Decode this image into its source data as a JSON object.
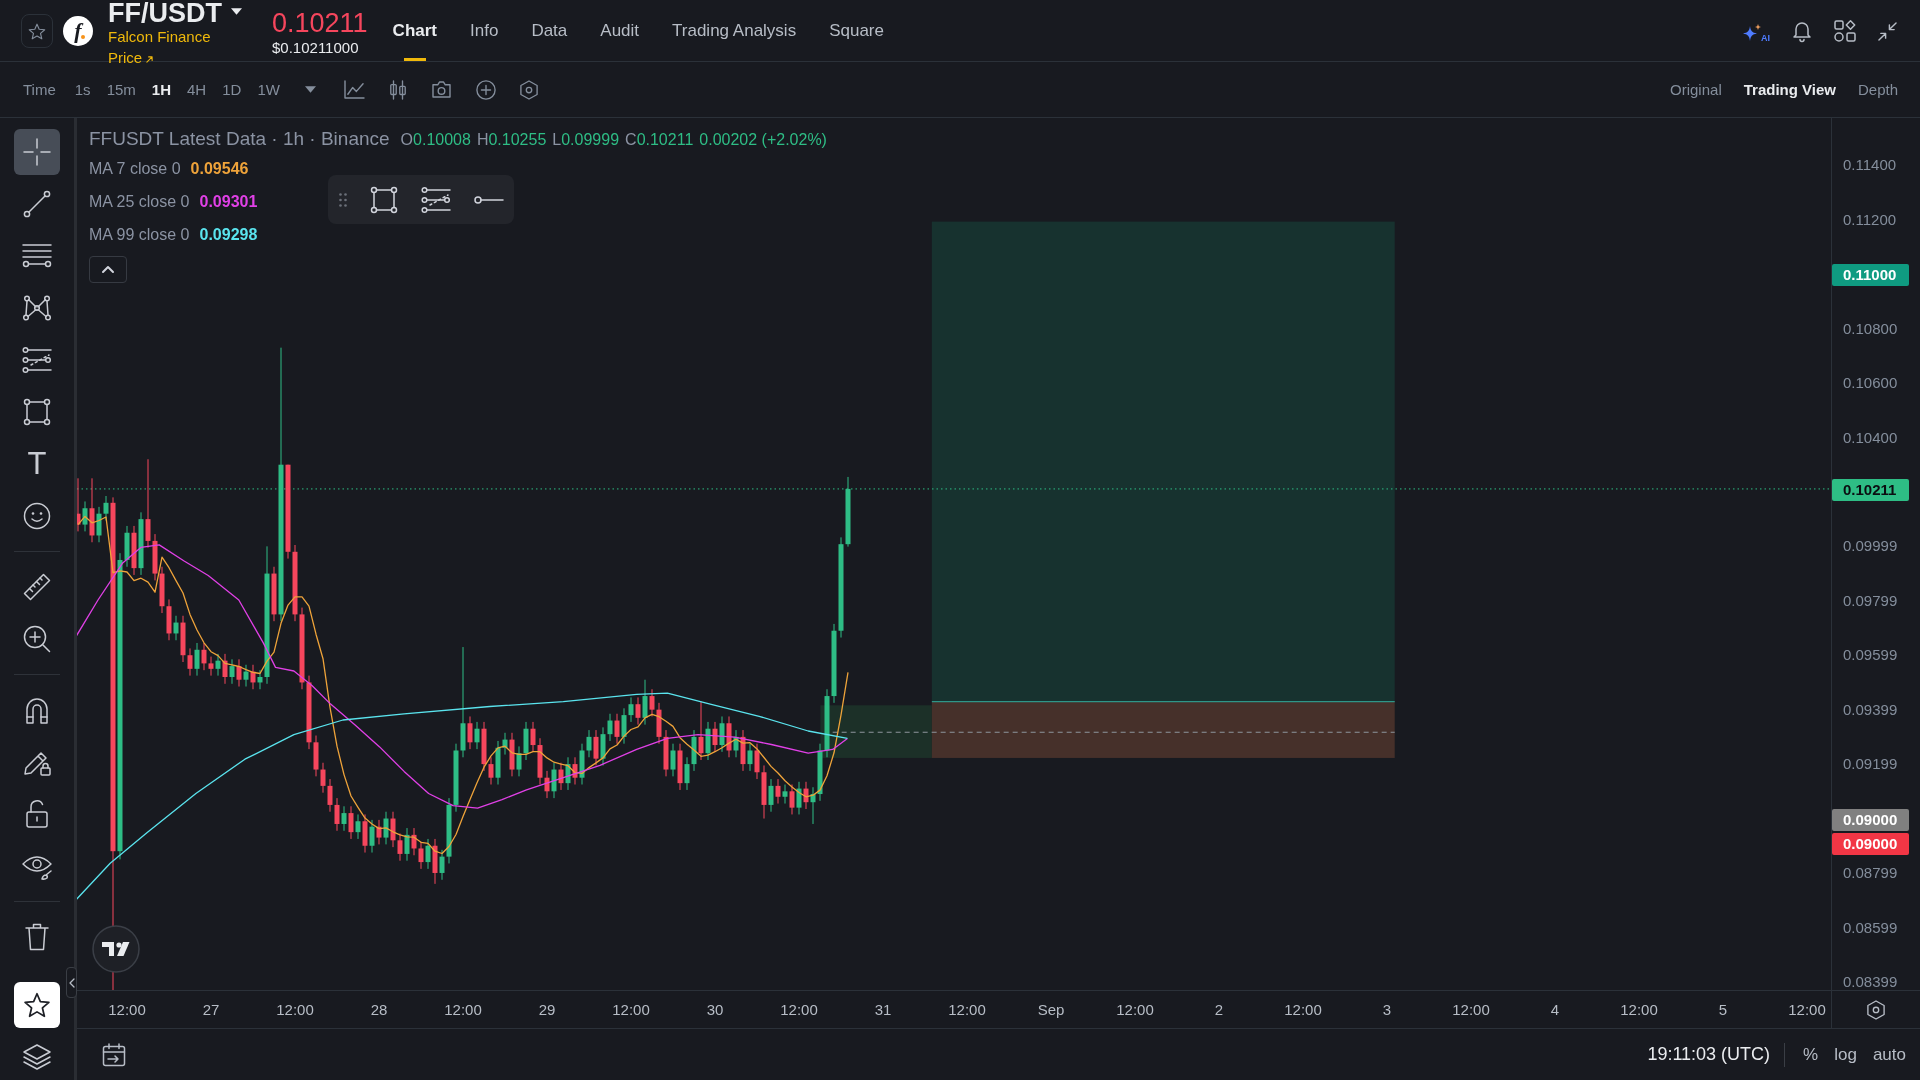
{
  "header": {
    "logo_mark": "f",
    "symbol": "FF/USDT",
    "coin_name": "Falcon Finance",
    "price_link": "Price",
    "last_price": "0.10211",
    "last_price_usd": "$0.10211000",
    "tabs": [
      {
        "label": "Chart",
        "selected": true
      },
      {
        "label": "Info",
        "selected": false
      },
      {
        "label": "Data",
        "selected": false
      },
      {
        "label": "Audit",
        "selected": false
      },
      {
        "label": "Trading Analysis",
        "selected": false
      },
      {
        "label": "Square",
        "selected": false
      }
    ],
    "ai_label": "AI"
  },
  "toolbar": {
    "time_label": "Time",
    "intervals": [
      {
        "label": "1s",
        "selected": false
      },
      {
        "label": "15m",
        "selected": false
      },
      {
        "label": "1H",
        "selected": true
      },
      {
        "label": "4H",
        "selected": false
      },
      {
        "label": "1D",
        "selected": false
      },
      {
        "label": "1W",
        "selected": false
      }
    ],
    "views": [
      {
        "label": "Original",
        "selected": false
      },
      {
        "label": "Trading View",
        "selected": true
      },
      {
        "label": "Depth",
        "selected": false
      }
    ]
  },
  "drawing_tools": {
    "groups": [
      [
        {
          "selected": true
        },
        {
          "selected": false
        },
        {
          "selected": false
        },
        {
          "selected": false
        },
        {
          "selected": false
        },
        {
          "selected": false
        },
        {
          "selected": false,
          "glyph": "T"
        },
        {
          "selected": false
        }
      ],
      [
        {
          "selected": false
        },
        {
          "selected": false
        }
      ],
      [
        {
          "selected": false
        },
        {
          "selected": false
        },
        {
          "selected": false
        },
        {
          "selected": false
        }
      ],
      [
        {
          "selected": false
        }
      ]
    ],
    "favorites": {
      "on": true
    }
  },
  "legend": {
    "title": "FFUSDT Latest Data · 1h · Binance",
    "ohlc": [
      {
        "label": "O",
        "value": "0.10008"
      },
      {
        "label": "H",
        "value": "0.10255"
      },
      {
        "label": "L",
        "value": "0.09999"
      },
      {
        "label": "C",
        "value": "0.10211"
      }
    ],
    "change": "0.00202 (+2.02%)",
    "indicators": [
      {
        "label": "MA 7 close 0",
        "value": "0.09546",
        "color": "#eea33a"
      },
      {
        "label": "MA 25 close 0",
        "value": "0.09301",
        "color": "#e040e6"
      },
      {
        "label": "MA 99 close 0",
        "value": "0.09298",
        "color": "#5ae4ee"
      }
    ]
  },
  "price_axis": {
    "ticks": [
      "0.11400",
      "0.11200",
      "0.10800",
      "0.10600",
      "0.10400",
      "0.09999",
      "0.09799",
      "0.09599",
      "0.09399",
      "0.09199",
      "0.08799",
      "0.08599",
      "0.08399"
    ],
    "tags": [
      {
        "label": "0.11000",
        "color": "#0f9b81"
      },
      {
        "label": "0.10211",
        "color": "#2ebd85"
      },
      {
        "label": "0.09000",
        "color": "#808080"
      },
      {
        "label": "0.09000",
        "color": "#f23645"
      }
    ]
  },
  "time_axis": {
    "labels": [
      "12:00",
      "27",
      "12:00",
      "28",
      "12:00",
      "29",
      "12:00",
      "30",
      "12:00",
      "31",
      "12:00",
      "Sep",
      "12:00",
      "2",
      "12:00",
      "3",
      "12:00",
      "4",
      "12:00",
      "5",
      "12:00"
    ]
  },
  "status_bar": {
    "time": "19:11:03 (UTC)",
    "scale_options": [
      "%",
      "log",
      "auto"
    ]
  }
}
